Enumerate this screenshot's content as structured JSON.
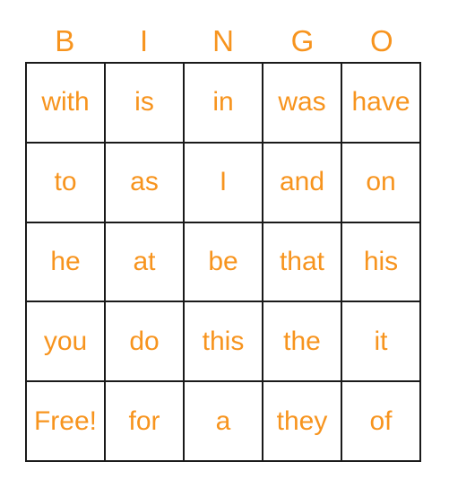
{
  "card": {
    "title": "BINGO",
    "accent_color": "#F7941E",
    "border_color": "#1a1a1a",
    "background_color": "#ffffff",
    "columns": 5,
    "rows": 5,
    "header_letters": [
      "B",
      "I",
      "N",
      "G",
      "O"
    ],
    "cells": [
      [
        "with",
        "is",
        "in",
        "was",
        "have"
      ],
      [
        "to",
        "as",
        "I",
        "and",
        "on"
      ],
      [
        "he",
        "at",
        "be",
        "that",
        "his"
      ],
      [
        "you",
        "do",
        "this",
        "the",
        "it"
      ],
      [
        "Free!",
        "for",
        "a",
        "they",
        "of"
      ]
    ],
    "free_space": {
      "label": "Free!",
      "row": 4,
      "column": 0
    }
  }
}
